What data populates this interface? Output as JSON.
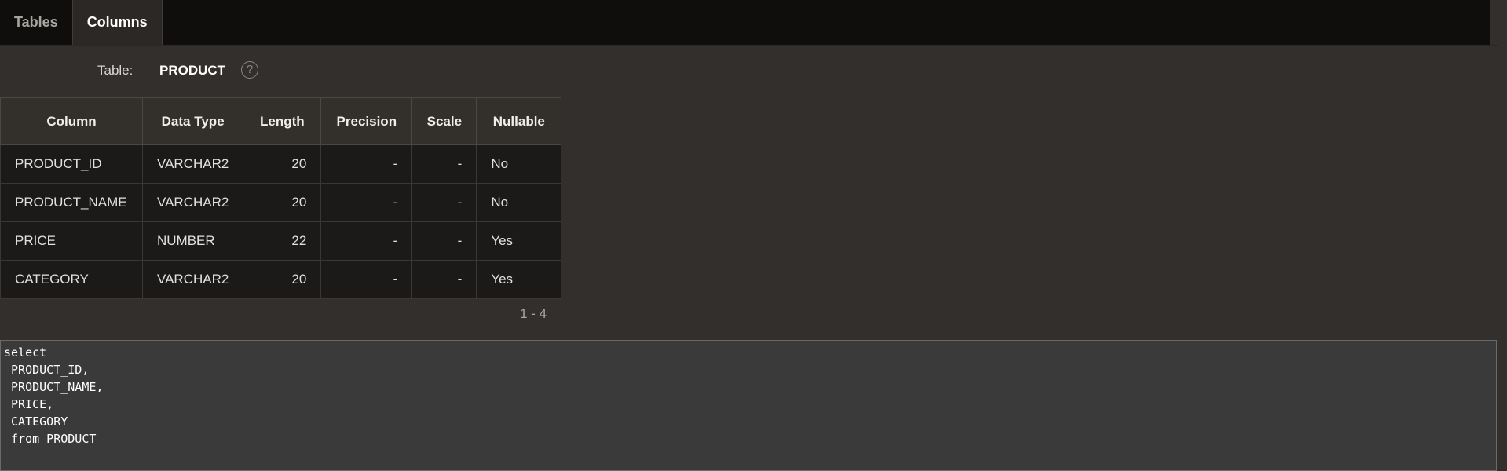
{
  "tabs": [
    {
      "label": "Tables",
      "active": false
    },
    {
      "label": "Columns",
      "active": true
    }
  ],
  "table_info": {
    "label": "Table:",
    "value": "PRODUCT",
    "help_icon": "?"
  },
  "columns_table": {
    "headers": [
      "Column",
      "Data Type",
      "Length",
      "Precision",
      "Scale",
      "Nullable"
    ],
    "rows": [
      [
        "PRODUCT_ID",
        "VARCHAR2",
        "20",
        "-",
        "-",
        "No"
      ],
      [
        "PRODUCT_NAME",
        "VARCHAR2",
        "20",
        "-",
        "-",
        "No"
      ],
      [
        "PRICE",
        "NUMBER",
        "22",
        "-",
        "-",
        "Yes"
      ],
      [
        "CATEGORY",
        "VARCHAR2",
        "20",
        "-",
        "-",
        "Yes"
      ]
    ]
  },
  "pagination": "1 - 4",
  "sql": {
    "lines": [
      "select",
      " PRODUCT_ID,",
      " PRODUCT_NAME,",
      " PRICE,",
      " CATEGORY",
      " from PRODUCT"
    ]
  },
  "colors": {
    "background": "#322f2c",
    "tabbar": "#0f0e0d",
    "sql_background": "#3a3a3a"
  }
}
